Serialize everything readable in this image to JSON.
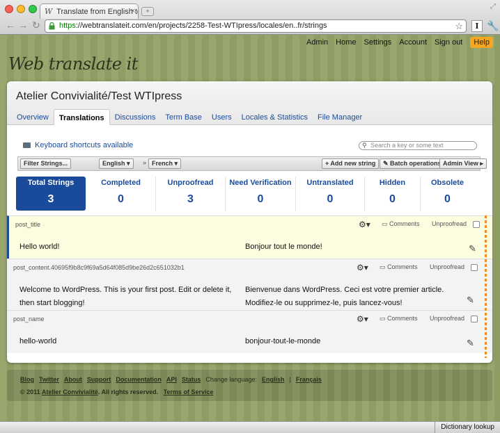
{
  "browser": {
    "tab_title": "Translate from English to Fre",
    "url_https": "https",
    "url_rest": "://webtranslateit.com/en/projects/2258-Test-WTIpress/locales/en..fr/strings"
  },
  "topnav": [
    "Admin",
    "Home",
    "Settings",
    "Account",
    "Sign out"
  ],
  "help_label": "Help",
  "logo": "Web translate it",
  "project": {
    "title": "Atelier Convivialité/Test WTIpress",
    "tabs": [
      "Overview",
      "Translations",
      "Discussions",
      "Term Base",
      "Users",
      "Locales & Statistics",
      "File Manager"
    ],
    "active_tab": "Translations"
  },
  "keyboard_shortcuts": "Keyboard shortcuts available",
  "search_placeholder": "Search a key or some text",
  "toolbar": {
    "filter": "Filter Strings...",
    "source_lang": "English",
    "target_lang": "French",
    "separator": "»",
    "add": "+ Add new string",
    "batch": "Batch operations",
    "admin_view": "Admin View"
  },
  "stats": [
    {
      "label": "Total Strings",
      "value": "3"
    },
    {
      "label": "Completed",
      "value": "0"
    },
    {
      "label": "Unproofread",
      "value": "3"
    },
    {
      "label": "Need Verification",
      "value": "0"
    },
    {
      "label": "Untranslated",
      "value": "0"
    },
    {
      "label": "Hidden",
      "value": "0"
    },
    {
      "label": "Obsolete",
      "value": "0"
    }
  ],
  "strings": [
    {
      "key": "post_title",
      "comments": "Comments",
      "status": "Unproofread",
      "source": "Hello world!",
      "target": "Bonjour tout le monde!"
    },
    {
      "key": "post_content.40695f9b8c9f69a5d64f085d9be26d2c651032b1",
      "comments": "Comments",
      "status": "Unproofread",
      "source": "Welcome to WordPress. This is your first post. Edit or delete it, then start blogging!",
      "target": "Bienvenue dans WordPress. Ceci est votre premier article. Modifiez-le ou supprimez-le, puis lancez-vous!"
    },
    {
      "key": "post_name",
      "comments": "Comments",
      "status": "Unproofread",
      "source": "hello-world",
      "target": "bonjour-tout-le-monde"
    }
  ],
  "footer": {
    "links": [
      "Blog",
      "Twitter",
      "About",
      "Support",
      "Documentation",
      "API",
      "Status"
    ],
    "change_language": "Change language:",
    "lang_english": "English",
    "lang_sep": "|",
    "lang_french": "Français",
    "copyright": "© 2011",
    "company": "Atelier Convivialité",
    "rights": ". All rights reserved.",
    "terms": "Terms of Service"
  },
  "dictionary_lookup": "Dictionary lookup",
  "colors": {
    "accent": "#1a4b9b",
    "help": "#f5a623",
    "background": "#93a266"
  }
}
